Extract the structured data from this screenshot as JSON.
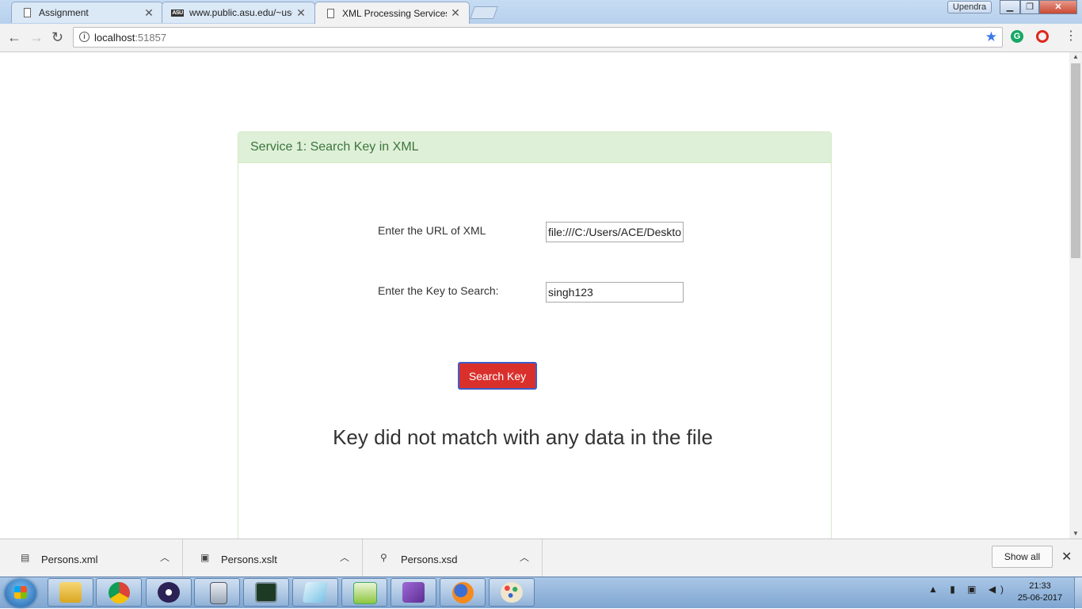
{
  "browser": {
    "tabs": [
      {
        "title": "Assignment",
        "icon": "page-icon"
      },
      {
        "title": "www.public.asu.edu/~use",
        "icon": "asu-icon"
      },
      {
        "title": "XML Processing Services",
        "icon": "page-icon",
        "active": true
      }
    ],
    "user": "Upendra",
    "url_host": "localhost",
    "url_port": ":51857"
  },
  "panel": {
    "heading": "Service 1: Search Key in XML",
    "url_label": "Enter the URL of XML",
    "url_value": "file:///C:/Users/ACE/Desktop",
    "key_label": "Enter the Key to Search:",
    "key_value": "singh123",
    "button_label": "Search Key",
    "result_text": "Key did not match with any data in the file"
  },
  "downloads": {
    "items": [
      {
        "name": "Persons.xml"
      },
      {
        "name": "Persons.xslt"
      },
      {
        "name": "Persons.xsd"
      }
    ],
    "show_all": "Show all"
  },
  "taskbar": {
    "time": "21:33",
    "date": "25-06-2017",
    "apps": [
      "explorer",
      "chrome",
      "eclipse",
      "calculator",
      "task-manager",
      "notepad",
      "notepad++",
      "visual-studio",
      "firefox",
      "paint"
    ]
  },
  "colors": {
    "panel_heading_bg": "#dff0d8",
    "panel_heading_text": "#3c763d",
    "button_bg": "#d9302c"
  }
}
